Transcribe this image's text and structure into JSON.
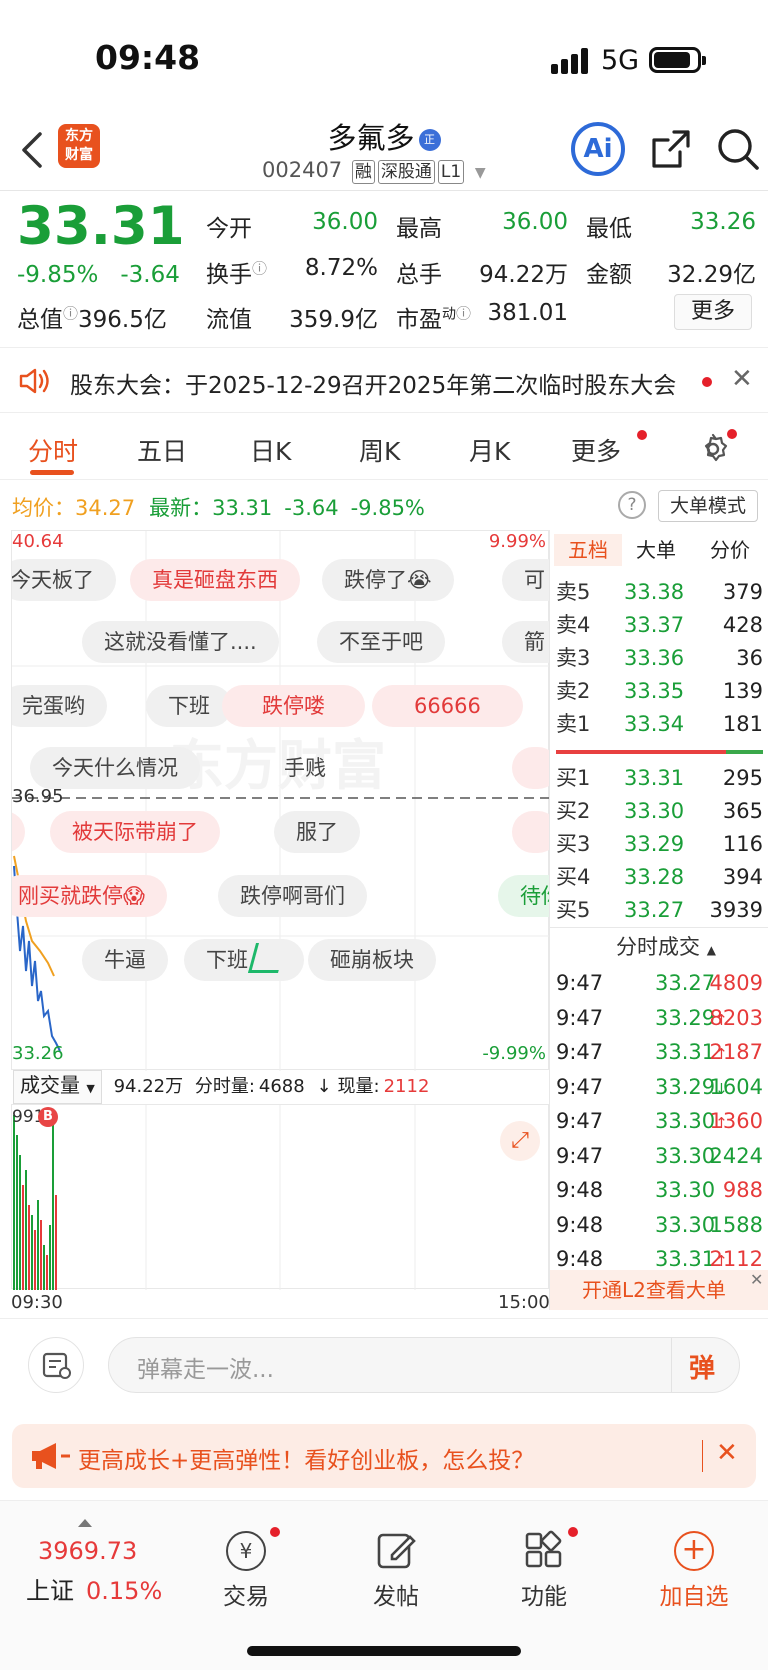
{
  "status_bar": {
    "time": "09:48",
    "network": "5G"
  },
  "header": {
    "logo_text_1": "东方",
    "logo_text_2": "财富",
    "stock_name": "多氟多",
    "name_badge": "正",
    "stock_code": "002407",
    "tags": [
      "融",
      "深股通",
      "L1"
    ],
    "ai_label": "Ai"
  },
  "quote": {
    "price": "33.31",
    "change_pct": "-9.85%",
    "change_amt": "-3.64",
    "open_label": "今开",
    "open": "36.00",
    "high_label": "最高",
    "high": "36.00",
    "low_label": "最低",
    "low": "33.26",
    "turnover_label": "换手",
    "turnover": "8.72%",
    "volume_label": "总手",
    "volume": "94.22万",
    "amount_label": "金额",
    "amount": "32.29亿",
    "mktcap_label": "总值",
    "mktcap": "396.5亿",
    "float_label": "流值",
    "float_cap": "359.9亿",
    "pe_label": "市盈",
    "pe_sup": "动",
    "pe": "381.01",
    "more_button": "更多"
  },
  "announcement": {
    "text": "股东大会：于2025-12-29召开2025年第二次临时股东大会"
  },
  "chart_tabs": [
    "分时",
    "五日",
    "日K",
    "周K",
    "月K",
    "更多"
  ],
  "chart_info": {
    "avg_label": "均价：",
    "avg": "34.27",
    "latest_label": "最新：",
    "latest": "33.31",
    "latest_chg": "-3.64",
    "latest_pct": "-9.85%",
    "mode_button": "大单模式",
    "top_price": "40.64",
    "top_pct": "9.99%",
    "mid_price": "36.95",
    "bottom_price": "33.26",
    "bottom_pct": "-9.99%"
  },
  "danmaku": [
    {
      "text": "今天板了",
      "style": "gray"
    },
    {
      "text": "真是砸盘东西",
      "style": "red"
    },
    {
      "text": "跌停了😭",
      "style": "gray"
    },
    {
      "text": "可",
      "style": "gray"
    },
    {
      "text": "这就没看懂了....",
      "style": "gray"
    },
    {
      "text": "不至于吧",
      "style": "gray"
    },
    {
      "text": "箭",
      "style": "gray"
    },
    {
      "text": "完蛋哟",
      "style": "gray"
    },
    {
      "text": "下班",
      "style": "gray"
    },
    {
      "text": "跌停喽",
      "style": "red"
    },
    {
      "text": "66666",
      "style": "red"
    },
    {
      "text": "今天什么情况",
      "style": "gray"
    },
    {
      "text": "手贱",
      "style": "gray"
    },
    {
      "text": "被天际带崩了",
      "style": "red"
    },
    {
      "text": "服了",
      "style": "gray"
    },
    {
      "text": "刚买就跌停😱",
      "style": "red"
    },
    {
      "text": "跌停啊哥们",
      "style": "gray"
    },
    {
      "text": "待你",
      "style": "green"
    },
    {
      "text": "牛逼",
      "style": "gray"
    },
    {
      "text": "下班",
      "style": "gray"
    },
    {
      "text": "砸崩板块",
      "style": "gray"
    }
  ],
  "volume_bar": {
    "selector": "成交量",
    "total": "94.22万",
    "fenshi_label": "分时量:",
    "fenshi": "4688",
    "now_label": "现量:",
    "now": "2112",
    "axis_top": "9913",
    "marker": "B",
    "time_start": "09:30",
    "time_end": "15:00"
  },
  "orderbook": {
    "tabs": [
      "五档",
      "大单",
      "分价"
    ],
    "asks": [
      {
        "label": "卖5",
        "price": "33.38",
        "vol": "379"
      },
      {
        "label": "卖4",
        "price": "33.37",
        "vol": "428"
      },
      {
        "label": "卖3",
        "price": "33.36",
        "vol": "36"
      },
      {
        "label": "卖2",
        "price": "33.35",
        "vol": "139"
      },
      {
        "label": "卖1",
        "price": "33.34",
        "vol": "181"
      }
    ],
    "bids": [
      {
        "label": "买1",
        "price": "33.31",
        "vol": "295"
      },
      {
        "label": "买2",
        "price": "33.30",
        "vol": "365"
      },
      {
        "label": "买3",
        "price": "33.29",
        "vol": "116"
      },
      {
        "label": "买4",
        "price": "33.28",
        "vol": "394"
      },
      {
        "label": "买5",
        "price": "33.27",
        "vol": "3939"
      }
    ],
    "ticks_title": "分时成交",
    "ticks": [
      {
        "time": "9:47",
        "price": "33.27",
        "arrow": "",
        "vol": "4809",
        "color": "red"
      },
      {
        "time": "9:47",
        "price": "33.29",
        "arrow": "↑",
        "vol": "8203",
        "color": "red"
      },
      {
        "time": "9:47",
        "price": "33.31",
        "arrow": "↑",
        "vol": "2187",
        "color": "red"
      },
      {
        "time": "9:47",
        "price": "33.29",
        "arrow": "↓",
        "vol": "1604",
        "color": "green"
      },
      {
        "time": "9:47",
        "price": "33.30",
        "arrow": "↑",
        "vol": "1360",
        "color": "red"
      },
      {
        "time": "9:47",
        "price": "33.30",
        "arrow": "",
        "vol": "2424",
        "color": "green"
      },
      {
        "time": "9:48",
        "price": "33.30",
        "arrow": "",
        "vol": "988",
        "color": "red"
      },
      {
        "time": "9:48",
        "price": "33.30",
        "arrow": "",
        "vol": "1588",
        "color": "green"
      },
      {
        "time": "9:48",
        "price": "33.31",
        "arrow": "↑",
        "vol": "2112",
        "color": "red"
      }
    ],
    "l2_banner": "开通L2查看大单"
  },
  "comment_input": {
    "placeholder": "弹幕走一波...",
    "send_label": "弹"
  },
  "promo": {
    "text": "更高成长+更高弹性！看好创业板，怎么投？"
  },
  "tabbar": {
    "index_value": "3969.73",
    "index_name": "上证",
    "index_pct": "0.15%",
    "items": [
      "交易",
      "发帖",
      "功能",
      "加自选"
    ]
  }
}
